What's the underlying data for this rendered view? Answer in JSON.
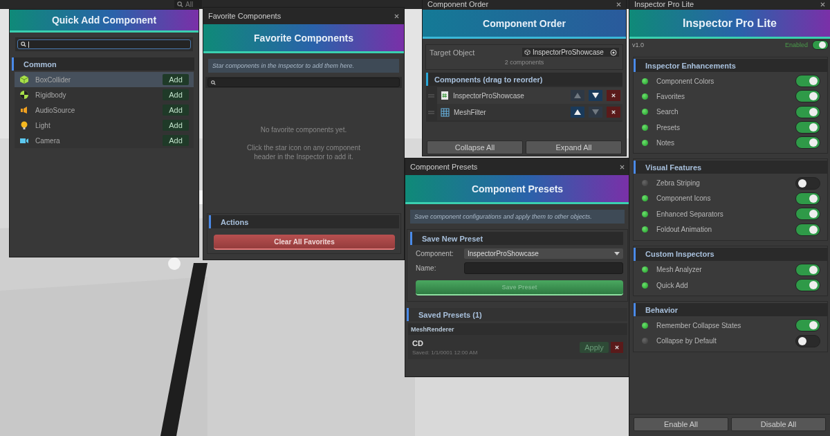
{
  "scene_toolbar": {
    "search_placeholder": "All"
  },
  "quick_add": {
    "title": "Quick Add Component",
    "category": "Common",
    "items": [
      {
        "name": "BoxCollider",
        "kind": "cube",
        "selected": true,
        "button": "Add"
      },
      {
        "name": "Rigidbody",
        "kind": "rigidbody",
        "selected": false,
        "button": "Add"
      },
      {
        "name": "AudioSource",
        "kind": "audio",
        "selected": false,
        "button": "Add"
      },
      {
        "name": "Light",
        "kind": "light",
        "selected": false,
        "button": "Add"
      },
      {
        "name": "Camera",
        "kind": "camera",
        "selected": false,
        "button": "Add"
      }
    ]
  },
  "favorites": {
    "window_title": "Favorite Components",
    "title": "Favorite Components",
    "hint": "Star components in the Inspector to add them here.",
    "empty_title": "No favorite components yet.",
    "empty_body": "Click the star icon on any component header in the Inspector to add it.",
    "section": "Actions",
    "clear_button": "Clear All Favorites"
  },
  "component_order": {
    "window_title": "Component Order",
    "title": "Component Order",
    "target_label": "Target Object",
    "target_value": "InspectorProShowcase",
    "count": "2 components",
    "section": "Components (drag to reorder)",
    "items": [
      {
        "name": "InspectorProShowcase",
        "kind": "script",
        "up_disabled": true,
        "down_disabled": false
      },
      {
        "name": "MeshFilter",
        "kind": "mesh",
        "up_disabled": false,
        "down_disabled": true
      }
    ],
    "buttons": [
      "Collapse All",
      "Expand All"
    ]
  },
  "presets": {
    "window_title": "Component Presets",
    "title": "Component Presets",
    "hint": "Save component configurations and apply them to other objects.",
    "save_section": "Save New Preset",
    "component_label": "Component:",
    "component_value": "InspectorProShowcase",
    "name_label": "Name:",
    "save_button": {
      "label": "Save Preset",
      "disabled": true
    },
    "saved_section": "Saved Presets (1)",
    "groups": [
      {
        "type": "MeshRenderer",
        "presets": [
          {
            "name": "CD",
            "saved": "Saved: 1/1/0001 12:00 AM",
            "apply": "Apply"
          }
        ]
      }
    ]
  },
  "inspector": {
    "window_title": "Inspector Pro Lite",
    "title": "Inspector Pro Lite",
    "version": "v1.0",
    "enabled_label": "Enabled",
    "enabled": true,
    "sections": [
      {
        "title": "Inspector Enhancements",
        "items": [
          {
            "label": "Component Colors",
            "on": true
          },
          {
            "label": "Favorites",
            "on": true
          },
          {
            "label": "Search",
            "on": true
          },
          {
            "label": "Presets",
            "on": true
          },
          {
            "label": "Notes",
            "on": true
          }
        ]
      },
      {
        "title": "Visual Features",
        "items": [
          {
            "label": "Zebra Striping",
            "on": false
          },
          {
            "label": "Component Icons",
            "on": true
          },
          {
            "label": "Enhanced Separators",
            "on": true
          },
          {
            "label": "Foldout Animation",
            "on": true
          }
        ]
      },
      {
        "title": "Custom Inspectors",
        "items": [
          {
            "label": "Mesh Analyzer",
            "on": true
          },
          {
            "label": "Quick Add",
            "on": true
          }
        ]
      },
      {
        "title": "Behavior",
        "items": [
          {
            "label": "Remember Collapse States",
            "on": true
          },
          {
            "label": "Collapse by Default",
            "on": false
          }
        ]
      }
    ],
    "buttons": [
      "Enable All",
      "Disable All"
    ]
  }
}
